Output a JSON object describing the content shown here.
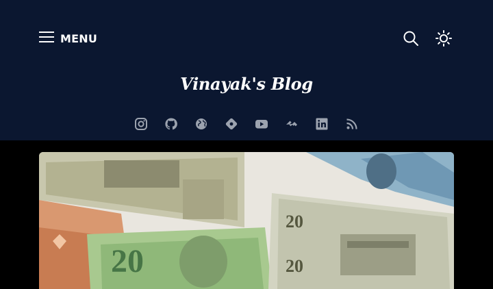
{
  "header": {
    "menu_label": "MENU",
    "site_title": "Vinayak's Blog"
  },
  "icons": {
    "menu": "hamburger-icon",
    "search": "search-icon",
    "theme": "sun-icon",
    "social": [
      "instagram-icon",
      "github-icon",
      "globe-icon",
      "location-diamond-icon",
      "youtube-icon",
      "hashnode-icon",
      "linkedin-icon",
      "rss-icon"
    ]
  },
  "hero_image": {
    "alt": "Assorted US dollar and Canadian dollar banknotes"
  },
  "colors": {
    "header_bg": "#0b1730",
    "icon": "#9ca3af",
    "page_bg": "#000000",
    "text": "#ffffff"
  }
}
